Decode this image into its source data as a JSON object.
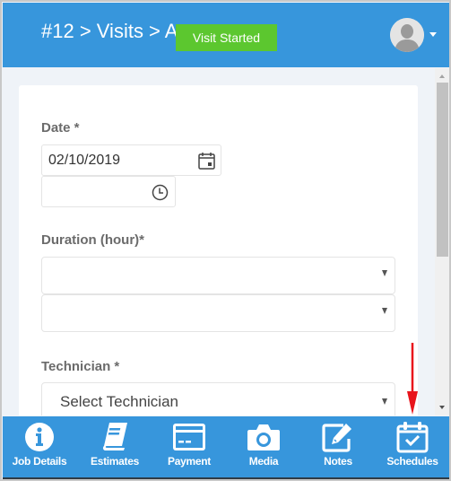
{
  "header": {
    "title": "#12 > Visits > A",
    "status_badge": "Visit Started",
    "avatar_icon": "user-avatar-icon",
    "dropdown_icon": "caret-down-icon"
  },
  "form": {
    "date": {
      "label": "Date *",
      "value": "02/10/2019",
      "icon": "calendar-icon"
    },
    "time": {
      "value": "",
      "icon": "clock-icon"
    },
    "duration": {
      "label": "Duration (hour)*",
      "select1_value": "",
      "select2_value": ""
    },
    "technician": {
      "label": "Technician *",
      "placeholder": "Select Technician"
    }
  },
  "tabbar": {
    "tabs": [
      {
        "label": "Job Details",
        "icon": "info-icon"
      },
      {
        "label": "Estimates",
        "icon": "book-icon"
      },
      {
        "label": "Payment",
        "icon": "credit-card-icon"
      },
      {
        "label": "Media",
        "icon": "camera-icon"
      },
      {
        "label": "Notes",
        "icon": "edit-note-icon"
      },
      {
        "label": "Schedules",
        "icon": "calendar-check-icon"
      }
    ]
  },
  "annotation": {
    "arrow_color": "#e8141c",
    "target": "Schedules"
  },
  "colors": {
    "primary": "#3796dc",
    "badge": "#5cc72f"
  }
}
